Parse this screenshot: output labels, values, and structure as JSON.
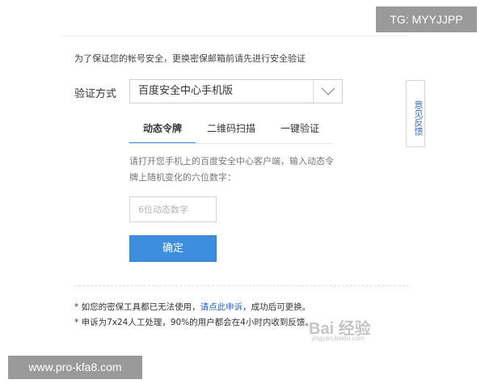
{
  "overlays": {
    "tg_badge": "TG: MYYJJPP",
    "site_badge": "www.pro-kfa8.com"
  },
  "intro": {
    "text": "为了保证您的帐号安全，更换密保邮箱前请先进行安全验证"
  },
  "verification": {
    "label": "验证方式",
    "selected": "百度安全中心手机版",
    "arrow_icon": "chevron-down-icon"
  },
  "tabs": [
    {
      "label": "动态令牌",
      "active": true
    },
    {
      "label": "二维码扫描",
      "active": false
    },
    {
      "label": "一键验证",
      "active": false
    }
  ],
  "form": {
    "instruction": "请打开您手机上的百度安全中心客户端，输入动态令牌上随机变化的六位数字：",
    "input_placeholder": "6位动态数字",
    "input_value": "",
    "confirm_label": "确定"
  },
  "notes": {
    "line1_prefix": "* 如您的密保工具都已无法使用，",
    "line1_link": "请点此申诉",
    "line1_suffix": "，成功后可更换。",
    "line2": "* 申诉为7x24人工处理，90%的用户都会在4小时内收到反馈。"
  },
  "feedback": {
    "label": "意见反馈"
  },
  "watermark": {
    "logo": "Bai 经验",
    "url": "jingyan.baidu.com"
  },
  "colors": {
    "accent": "#3e8ee0",
    "link": "#2b64c4",
    "badge": "#9a9a9a"
  }
}
